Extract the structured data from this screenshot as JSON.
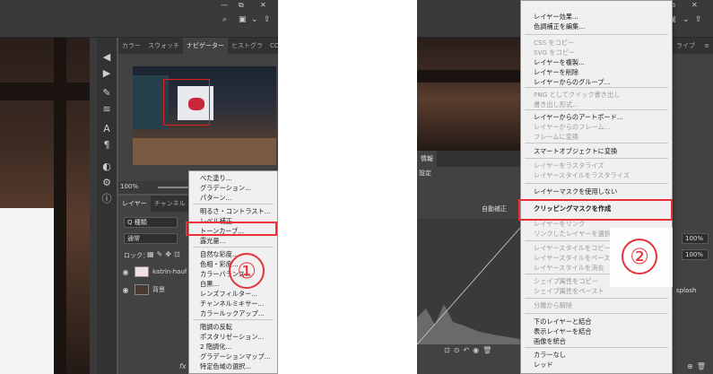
{
  "left": {
    "panel_tabs": [
      "カラー",
      "スウォッチ",
      "ナビゲーター",
      "ヒストグラ",
      "CC ライブ"
    ],
    "zoom": "100%",
    "layer_tabs": [
      "レイヤー",
      "チャンネル",
      "パ"
    ],
    "filter_label": "Q 種類",
    "blend_mode": "通常",
    "lock_label": "ロック：",
    "layers": [
      {
        "name": "katrin-hauf"
      },
      {
        "name": "背景"
      }
    ],
    "menu_items": [
      {
        "label": "べた塗り...",
        "disabled": false
      },
      {
        "label": "グラデーション...",
        "disabled": false
      },
      {
        "label": "パターン...",
        "disabled": false
      },
      {
        "label": "明るさ・コントラスト...",
        "disabled": false
      },
      {
        "label": "レベル補正...",
        "disabled": false
      },
      {
        "label": "トーンカーブ...",
        "disabled": false
      },
      {
        "label": "露光量...",
        "disabled": false
      },
      {
        "label": "自然な彩度...",
        "disabled": false
      },
      {
        "label": "色相・彩度...",
        "disabled": false
      },
      {
        "label": "カラーバランス...",
        "disabled": false
      },
      {
        "label": "白黒...",
        "disabled": false
      },
      {
        "label": "レンズフィルター...",
        "disabled": false
      },
      {
        "label": "チャンネルミキサー...",
        "disabled": false
      },
      {
        "label": "カラールックアップ...",
        "disabled": false
      },
      {
        "label": "階調の反転",
        "disabled": false
      },
      {
        "label": "ポスタリゼーション...",
        "disabled": false
      },
      {
        "label": "2 階調化...",
        "disabled": false
      },
      {
        "label": "グラデーションマップ...",
        "disabled": false
      },
      {
        "label": "特定色域の選択...",
        "disabled": false
      }
    ],
    "annotation": "①"
  },
  "right": {
    "panel_tabs_fragment": "ライブ",
    "info_tab": "情報",
    "curves_preset": "設定",
    "auto_button": "自動補正",
    "opacity": "100%",
    "fill": "100%",
    "layer_name_fragment": "splash",
    "menu_items": [
      {
        "label": "レイヤー効果...",
        "disabled": false,
        "bold": false
      },
      {
        "label": "色調補正を編集...",
        "disabled": false,
        "bold": false
      },
      {
        "label": "CSS をコピー",
        "disabled": true,
        "bold": false
      },
      {
        "label": "SVG をコピー",
        "disabled": true,
        "bold": false
      },
      {
        "label": "レイヤーを複製...",
        "disabled": false,
        "bold": false
      },
      {
        "label": "レイヤーを削除",
        "disabled": false,
        "bold": false
      },
      {
        "label": "レイヤーからのグループ...",
        "disabled": false,
        "bold": false
      },
      {
        "label": "PNG としてクイック書き出し",
        "disabled": true,
        "bold": false
      },
      {
        "label": "書き出し形式...",
        "disabled": true,
        "bold": false
      },
      {
        "label": "レイヤーからのアートボード...",
        "disabled": false,
        "bold": false
      },
      {
        "label": "レイヤーからのフレーム...",
        "disabled": true,
        "bold": false
      },
      {
        "label": "フレームに変換",
        "disabled": true,
        "bold": false
      },
      {
        "label": "スマートオブジェクトに変換",
        "disabled": false,
        "bold": false
      },
      {
        "label": "レイヤーをラスタライズ",
        "disabled": true,
        "bold": false
      },
      {
        "label": "レイヤースタイルをラスタライズ",
        "disabled": true,
        "bold": false
      },
      {
        "label": "レイヤーマスクを使用しない",
        "disabled": false,
        "bold": false
      },
      {
        "label": "クリッピングマスクを作成",
        "disabled": false,
        "bold": true
      },
      {
        "label": "レイヤーをリンク",
        "disabled": true,
        "bold": false
      },
      {
        "label": "リンクしたレイヤーを選択",
        "disabled": true,
        "bold": false
      },
      {
        "label": "レイヤースタイルをコピー",
        "disabled": true,
        "bold": false
      },
      {
        "label": "レイヤースタイルをペースト",
        "disabled": true,
        "bold": false
      },
      {
        "label": "レイヤースタイルを消去",
        "disabled": true,
        "bold": false
      },
      {
        "label": "シェイプ属性をコピー",
        "disabled": true,
        "bold": false
      },
      {
        "label": "シェイプ属性をペースト",
        "disabled": true,
        "bold": false
      },
      {
        "label": "分離から解除",
        "disabled": true,
        "bold": false
      },
      {
        "label": "下のレイヤーと結合",
        "disabled": false,
        "bold": false
      },
      {
        "label": "表示レイヤーを結合",
        "disabled": false,
        "bold": false
      },
      {
        "label": "画像を統合",
        "disabled": false,
        "bold": false
      },
      {
        "label": "カラーなし",
        "disabled": false,
        "bold": false
      },
      {
        "label": "レッド",
        "disabled": false,
        "bold": false
      }
    ],
    "annotation": "②"
  },
  "colors": {
    "highlight": "#e8323a",
    "menu_bg": "#f0f0f0",
    "panel_bg": "#424242"
  }
}
